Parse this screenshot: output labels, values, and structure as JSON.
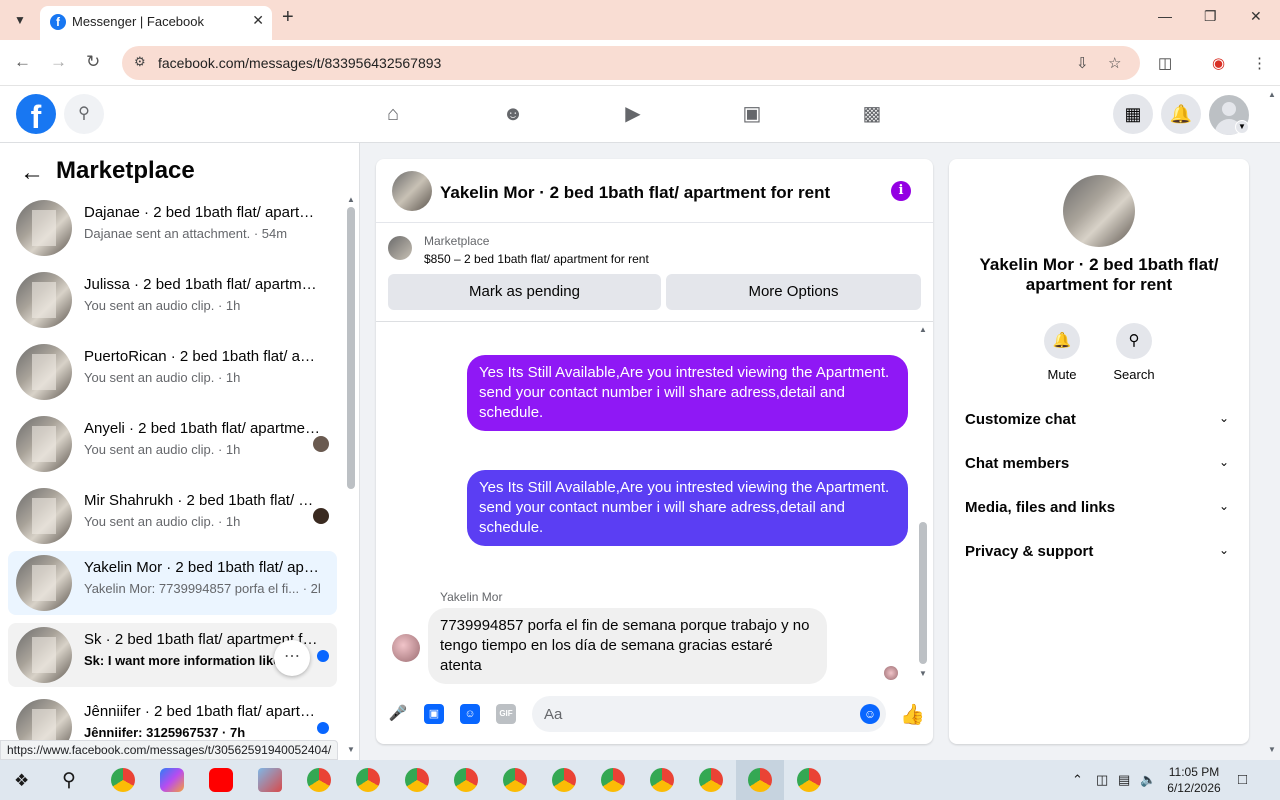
{
  "browser": {
    "tab_title": "Messenger | Facebook",
    "url": "facebook.com/messages/t/833956432567893",
    "status_url": "https://www.facebook.com/messages/t/30562591940052404/"
  },
  "sidebar": {
    "title": "Marketplace",
    "conversations": [
      {
        "name": "Dajanae · 2 bed 1bath flat/ apartment for rent",
        "preview": "Dajanae sent an attachment. · 54m",
        "unread": false
      },
      {
        "name": "Julissa · 2 bed 1bath flat/ apartment for rent",
        "preview": "You sent an audio clip. · 1h",
        "unread": false
      },
      {
        "name": "PuertoRican · 2 bed 1bath flat/ apartment for rent",
        "preview": "You sent an audio clip. · 1h",
        "unread": false
      },
      {
        "name": "Anyeli · 2 bed 1bath flat/ apartment for rent",
        "preview": "You sent an audio clip. · 1h",
        "unread": false
      },
      {
        "name": "Mir Shahrukh · 2 bed 1bath flat/ apartment for rent",
        "preview": "You sent an audio clip. · 1h",
        "unread": false
      },
      {
        "name": "Yakelin Mor · 2 bed 1bath flat/ apartment for rent",
        "preview": "Yakelin Mor: 7739994857 porfa el fi... · 2h",
        "unread": false
      },
      {
        "name": "Sk · 2 bed 1bath flat/ apartment for rent",
        "preview": "Sk: I want more information like...",
        "unread": true
      },
      {
        "name": "Jênniifer · 2 bed 1bath flat/ apartment for rent",
        "preview": "Jênniifer: 3125967537 · 7h",
        "unread": true
      }
    ]
  },
  "chat": {
    "title": "Yakelin Mor · 2 bed 1bath flat/ apartment for rent",
    "marketplace_label": "Marketplace",
    "listing": "$850 – 2 bed 1bath flat/ apartment for rent",
    "pending_button": "Mark as pending",
    "options_button": "More Options",
    "messages": [
      {
        "text": "Yes Its Still Available,Are you intrested viewing the Apartment. send your contact number i will share adress,detail and schedule."
      },
      {
        "text": "Yes Its Still Available,Are you intrested viewing the Apartment. send your contact number i will share adress,detail and schedule."
      }
    ],
    "incoming_sender": "Yakelin Mor",
    "incoming_text": "7739994857 porfa el fin de semana porque trabajo y no tengo tiempo en los día de semana gracias estaré atenta",
    "composer_placeholder": "Aa",
    "gif_label": "GIF"
  },
  "info": {
    "title": "Yakelin Mor · 2 bed 1bath flat/ apartment for rent",
    "mute_label": "Mute",
    "search_label": "Search",
    "rows": [
      "Customize chat",
      "Chat members",
      "Media, files and links",
      "Privacy & support"
    ]
  },
  "taskbar": {
    "time": "11:05 PM",
    "date": "6/12/2026"
  },
  "colors": {
    "fb_blue": "#1877f2",
    "bubble_purple": "#8f18f5",
    "bubble_indigo": "#5b3ef3",
    "unread_dot": "#0866ff"
  }
}
